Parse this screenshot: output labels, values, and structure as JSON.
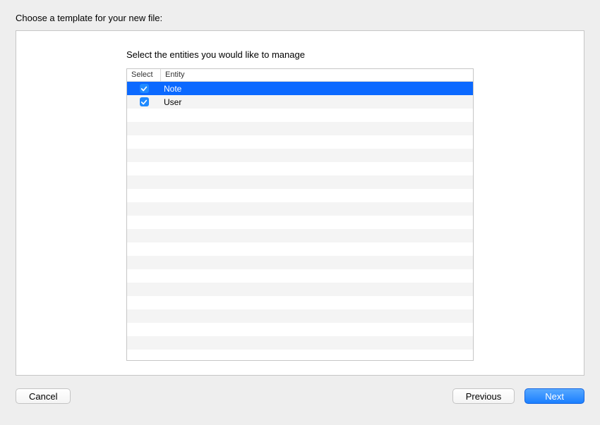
{
  "page": {
    "title": "Choose a template for your new file:"
  },
  "panel": {
    "subtitle": "Select the entities you would like to manage"
  },
  "columns": {
    "select": "Select",
    "entity": "Entity"
  },
  "rows": [
    {
      "entity": "Note",
      "checked": true,
      "selected": true
    },
    {
      "entity": "User",
      "checked": true,
      "selected": false
    }
  ],
  "buttons": {
    "cancel": "Cancel",
    "previous": "Previous",
    "next": "Next"
  },
  "blank_row_count": 19
}
